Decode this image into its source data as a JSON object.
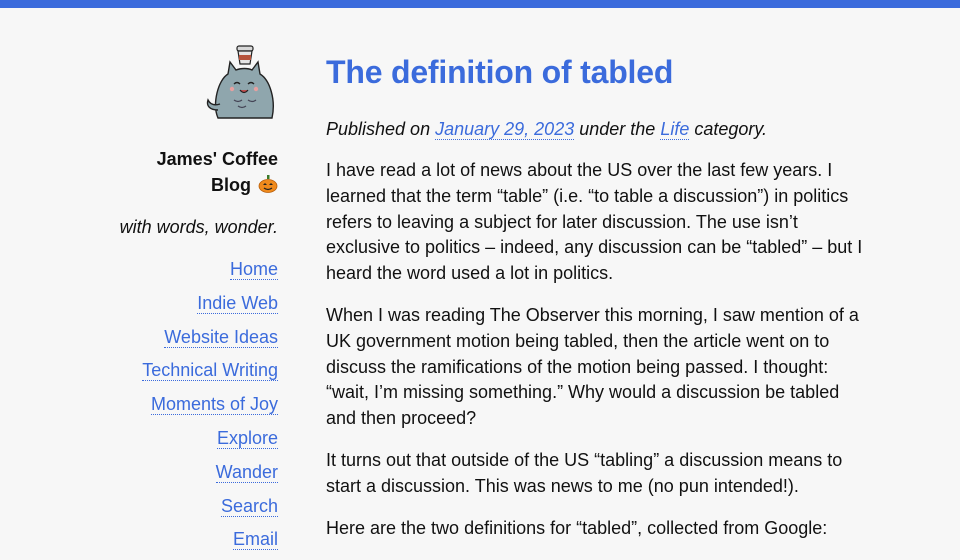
{
  "site": {
    "name_line1": "James' Coffee",
    "name_line2": "Blog",
    "tagline": "with words, wonder."
  },
  "nav": [
    {
      "label": "Home"
    },
    {
      "label": "Indie Web"
    },
    {
      "label": "Website Ideas"
    },
    {
      "label": "Technical Writing"
    },
    {
      "label": "Moments of Joy"
    },
    {
      "label": "Explore"
    },
    {
      "label": "Wander"
    },
    {
      "label": "Search"
    },
    {
      "label": "Email"
    }
  ],
  "post": {
    "title": "The definition of tabled",
    "meta_prefix": "Published on",
    "date": "January 29, 2023",
    "meta_middle": "under the",
    "category": "Life",
    "meta_suffix": "category.",
    "paragraphs": [
      "I have read a lot of news about the US over the last few years. I learned that the term “table” (i.e. “to table a discussion”) in politics refers to leaving a subject for later discussion. The use isn’t exclusive to politics – indeed, any discussion can be “tabled” – but I heard the word used a lot in politics.",
      "When I was reading The Observer this morning, I saw mention of a UK government motion being tabled, then the article went on to discuss the ramifications of the motion being passed. I thought: “wait, I’m missing something.” Why would a discussion be tabled and then proceed?",
      "It turns out that outside of the US “tabling” a discussion means to start a discussion. This was news to me (no pun intended!).",
      "Here are the two definitions for “tabled”, collected from Google:"
    ]
  },
  "colors": {
    "accent": "#3b6bdc",
    "background": "#f7f7f7",
    "text": "#111111"
  },
  "icons": {
    "logo": "cat-with-coffee-cup-icon",
    "emoji": "pumpkin-icon"
  }
}
